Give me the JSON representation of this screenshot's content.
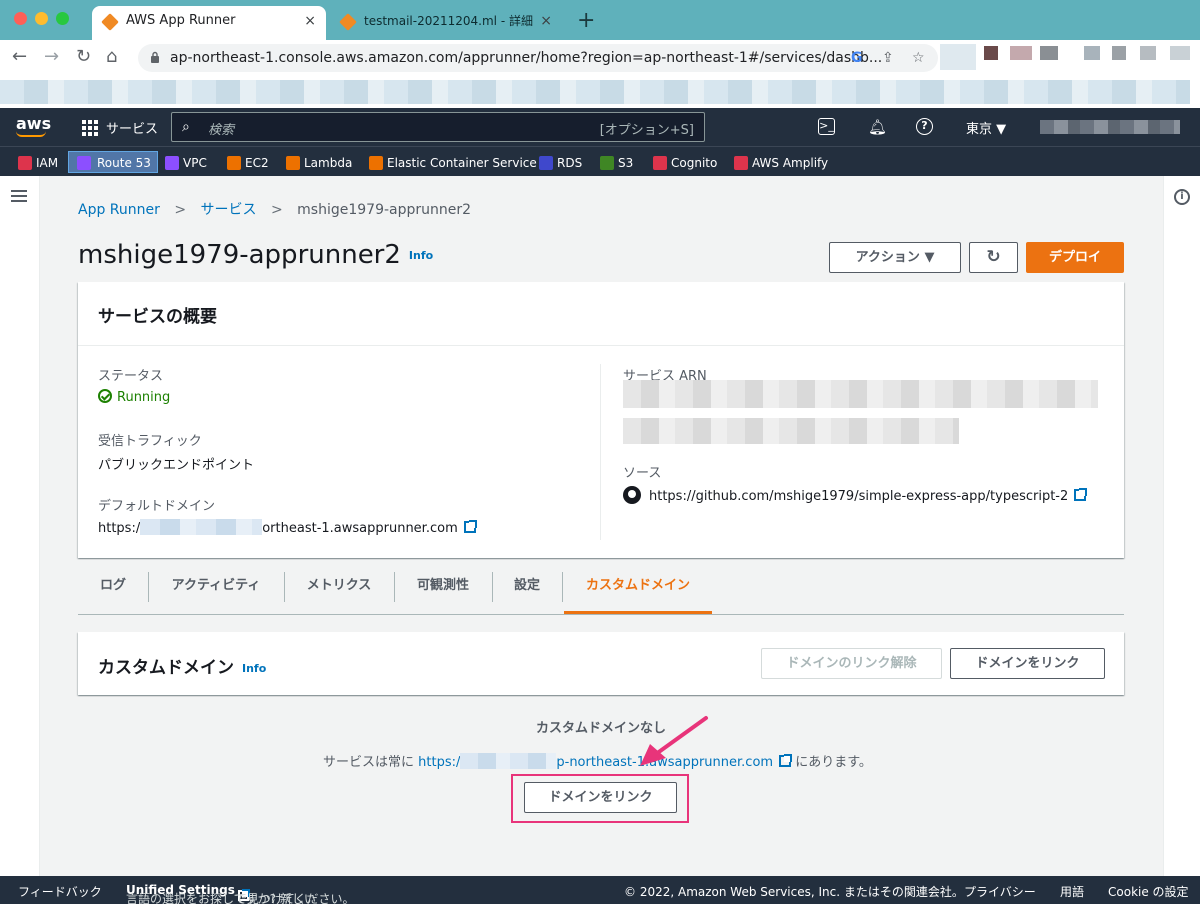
{
  "browser": {
    "tabs": [
      {
        "title": "AWS App Runner",
        "active": true
      },
      {
        "title": "testmail-20211204.ml - 詳細",
        "active": false
      }
    ],
    "new_tab": "+",
    "url": "ap-northeast-1.console.aws.amazon.com/apprunner/home?region=ap-northeast-1#/services/dashb...",
    "back": "←",
    "forward": "→",
    "reload": "↻",
    "home": "⌂",
    "close": "×"
  },
  "aws_nav": {
    "logo": "aws",
    "services_label": "サービス",
    "search_placeholder": "検索",
    "search_shortcut": "[オプション+S]",
    "region": "東京 ▼"
  },
  "favorites": [
    {
      "label": "IAM",
      "color": "#dd344c"
    },
    {
      "label": "Route 53",
      "color": "#8c4fff"
    },
    {
      "label": "VPC",
      "color": "#8c4fff"
    },
    {
      "label": "EC2",
      "color": "#ed7100"
    },
    {
      "label": "Lambda",
      "color": "#ed7100"
    },
    {
      "label": "Elastic Container Service",
      "color": "#ed7100"
    },
    {
      "label": "RDS",
      "color": "#3f48cc"
    },
    {
      "label": "S3",
      "color": "#3f8624"
    },
    {
      "label": "Cognito",
      "color": "#dd344c"
    },
    {
      "label": "AWS Amplify",
      "color": "#dd344c"
    }
  ],
  "breadcrumb": {
    "items": [
      "App Runner",
      "サービス"
    ],
    "current": "mshige1979-apprunner2",
    "separator": ">"
  },
  "page": {
    "title": "mshige1979-apprunner2",
    "info": "Info",
    "actions_label": "アクション ▼",
    "refresh": "↻",
    "deploy_label": "デプロイ"
  },
  "overview": {
    "title": "サービスの概要",
    "status_label": "ステータス",
    "status_value": "Running",
    "traffic_label": "受信トラフィック",
    "traffic_value": "パブリックエンドポイント",
    "default_domain_label": "デフォルトドメイン",
    "default_domain_prefix": "https:/",
    "default_domain_suffix": "ortheast-1.awsapprunner.com",
    "arn_label": "サービス ARN",
    "source_label": "ソース",
    "source_value": "https://github.com/mshige1979/simple-express-app/typescript-2"
  },
  "tabs": [
    "ログ",
    "アクティビティ",
    "メトリクス",
    "可観測性",
    "設定",
    "カスタムドメイン"
  ],
  "custom_domain": {
    "title": "カスタムドメイン",
    "info": "Info",
    "unlink_label": "ドメインのリンク解除",
    "link_label": "ドメインをリンク",
    "empty_title": "カスタムドメインなし",
    "desc_prefix": "サービスは常に",
    "desc_url_prefix": "https:/",
    "desc_url_suffix": "p-northeast-1.awsapprunner.com",
    "desc_suffix": "にあります。",
    "empty_button": "ドメインをリンク"
  },
  "footer": {
    "feedback": "フィードバック",
    "lang_prefix": "言語の選択をお探しですか? 新しい",
    "unified": "Unified Settings",
    "lang_suffix": "で見つけてください。",
    "copyright": "© 2022, Amazon Web Services, Inc. またはその関連会社。",
    "privacy": "プライバシー",
    "terms": "用語",
    "cookie": "Cookie の設定"
  },
  "colors": {
    "accent": "#ec7211",
    "link": "#0073bb",
    "ok": "#1d8102",
    "nav_bg": "#232f3e",
    "annotation": "#e8347a"
  }
}
